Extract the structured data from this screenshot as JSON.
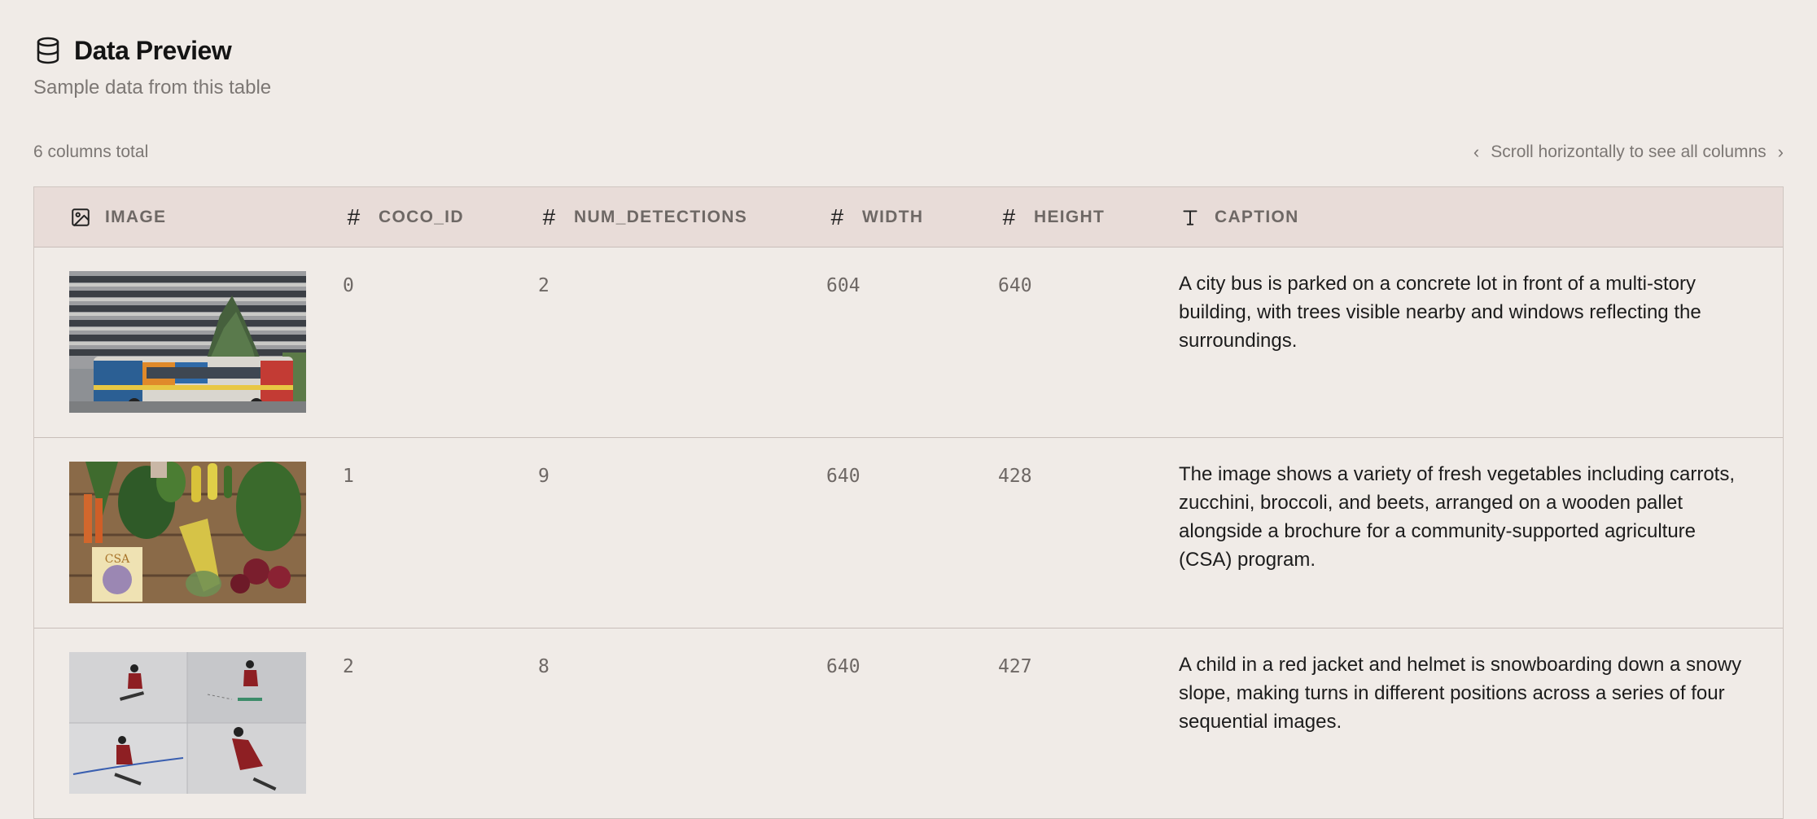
{
  "header": {
    "title": "Data Preview",
    "subtitle": "Sample data from this table",
    "icon": "database-icon"
  },
  "meta": {
    "columns_total": "6 columns total",
    "scroll_hint": "Scroll horizontally to see all columns"
  },
  "columns": [
    {
      "label": "IMAGE",
      "icon": "image-icon"
    },
    {
      "label": "COCO_ID",
      "icon": "hash-icon"
    },
    {
      "label": "NUM_DETECTIONS",
      "icon": "hash-icon"
    },
    {
      "label": "WIDTH",
      "icon": "hash-icon"
    },
    {
      "label": "HEIGHT",
      "icon": "hash-icon"
    },
    {
      "label": "CAPTION",
      "icon": "text-icon"
    }
  ],
  "rows": [
    {
      "coco_id": "0",
      "num_detections": "2",
      "width": "604",
      "height": "640",
      "caption": "A city bus is parked on a concrete lot in front of a multi-story building, with trees visible nearby and windows reflecting the surroundings."
    },
    {
      "coco_id": "1",
      "num_detections": "9",
      "width": "640",
      "height": "428",
      "caption": "The image shows a variety of fresh vegetables including carrots, zucchini, broccoli, and beets, arranged on a wooden pallet alongside a brochure for a community-supported agriculture (CSA) program."
    },
    {
      "coco_id": "2",
      "num_detections": "8",
      "width": "640",
      "height": "427",
      "caption": "A child in a red jacket and helmet is snowboarding down a snowy slope, making turns in different positions across a series of four sequential images."
    }
  ],
  "thumbnail_labels": {
    "csa_brochure": "CSA"
  }
}
